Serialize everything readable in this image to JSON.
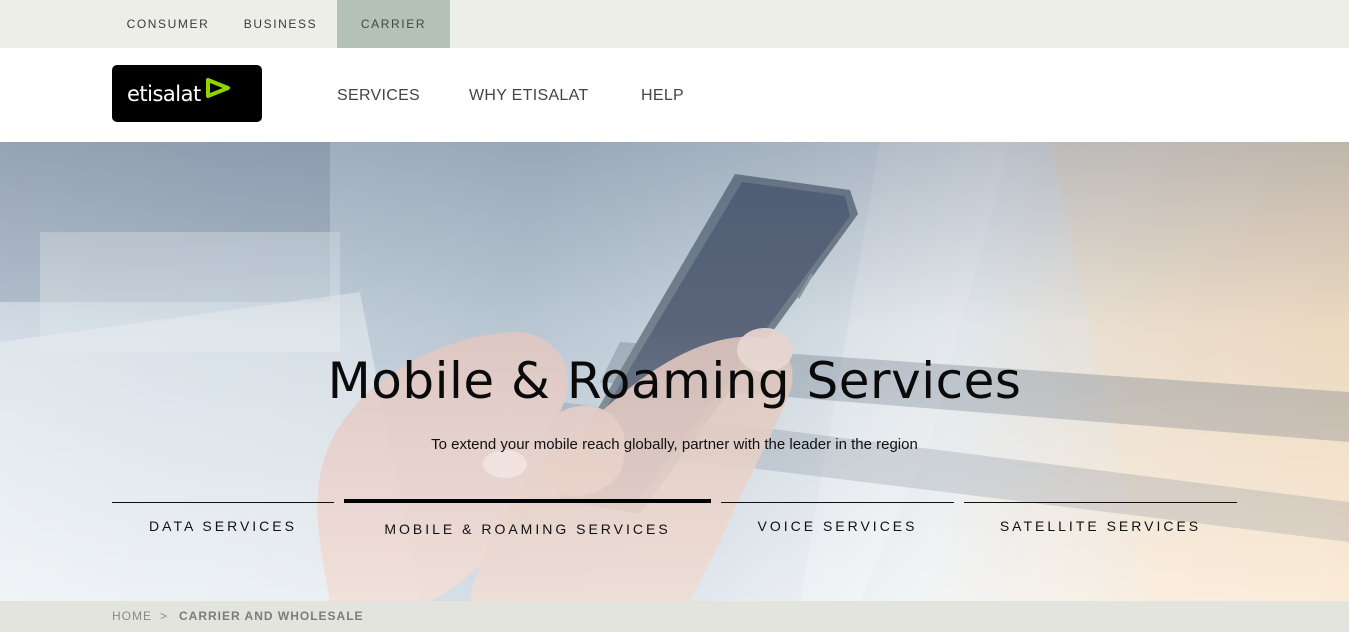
{
  "top_segments": {
    "consumer": "CONSUMER",
    "business": "BUSINESS",
    "carrier": "CARRIER"
  },
  "header": {
    "logo_text": "etisalat",
    "nav": {
      "services": "SERVICES",
      "why": "WHY ETISALAT",
      "help": "HELP"
    }
  },
  "hero": {
    "title": "Mobile & Roaming Services",
    "subtitle": "To extend your mobile reach globally, partner with the leader in the region",
    "tabs": {
      "data": "DATA SERVICES",
      "mobile": "MOBILE & ROAMING SERVICES",
      "voice": "VOICE SERVICES",
      "satellite": "SATELLITE SERVICES"
    }
  },
  "breadcrumb": {
    "home": "HOME",
    "separator": ">",
    "current": "CARRIER AND WHOLESALE"
  },
  "colors": {
    "segment_bar_bg": "#eeeee9",
    "carrier_active_bg": "#b4c1b7",
    "logo_bg": "#000000",
    "logo_mark": "#8fd400",
    "breadcrumb_bg": "#e4e4df"
  },
  "icons": {
    "logo_mark": "etisalat-arrow-icon"
  }
}
